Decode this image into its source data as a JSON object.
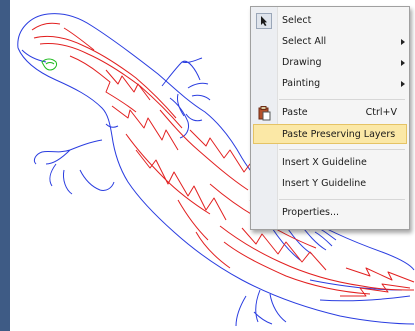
{
  "context_menu": {
    "select": "Select",
    "select_all": "Select All",
    "drawing": "Drawing",
    "painting": "Painting",
    "paste": "Paste",
    "paste_shortcut": "Ctrl+V",
    "paste_preserving_layers": "Paste Preserving Layers",
    "insert_x_guideline": "Insert X Guideline",
    "insert_y_guideline": "Insert Y Guideline",
    "properties": "Properties..."
  },
  "colors": {
    "outline": "#2a3de0",
    "stripes": "#e22020",
    "eye": "#22bb22",
    "menu_highlight": "#fbe8a6",
    "left_strip": "#3e5b85"
  },
  "icons": {
    "select": "pointer-arrow-icon",
    "paste": "clipboard-icon",
    "submenu": "submenu-arrow-icon"
  }
}
